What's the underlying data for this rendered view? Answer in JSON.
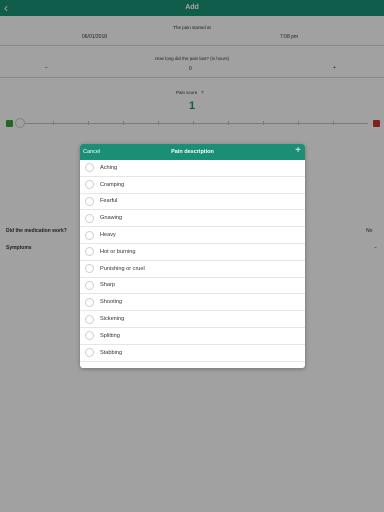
{
  "header": {
    "title": "Add"
  },
  "form": {
    "pain_started_label": "The pain started at",
    "date_value": "06/01/2018",
    "time_value": "7:08 pm",
    "duration_label": "How long did the pain last? (in hours)",
    "duration_value": "0",
    "minus": "−",
    "plus": "+",
    "pain_score_label": "Pain score",
    "help": "?",
    "pain_score_value": "1",
    "medication_worked_label": "Did the medication work?",
    "medication_worked_value": "No",
    "symptoms_label": "Symptoms"
  },
  "modal": {
    "title": "Pain description",
    "cancel": "Cancel",
    "add": "+",
    "items": [
      "Aching",
      "Cramping",
      "Fearful",
      "Gnawing",
      "Heavy",
      "Hot or burning",
      "Punishing or cruel",
      "Sharp",
      "Shooting",
      "Sickening",
      "Splitting",
      "Stabbing"
    ]
  },
  "colors": {
    "accent": "#1b8f76"
  }
}
